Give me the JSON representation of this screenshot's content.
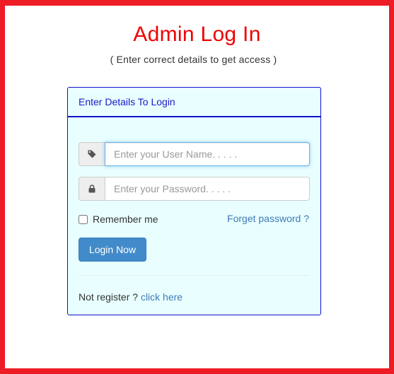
{
  "header": {
    "title": "Admin Log In",
    "subtitle": "( Enter correct details to get access )"
  },
  "panel": {
    "heading": "Enter Details To Login"
  },
  "form": {
    "username_placeholder": "Enter your User Name. . . . .",
    "username_icon": "tag-icon",
    "password_placeholder": "Enter your Password. . . . .",
    "password_icon": "lock-icon",
    "remember_label": "Remember me",
    "forgot_label": "Forget password ?",
    "login_label": "Login Now",
    "register_prefix": "Not register ?",
    "register_link": "click here"
  },
  "colors": {
    "frame": "#ee1c25",
    "title": "#ee0000",
    "panel_border": "#1010c8",
    "panel_bg": "#e9ffff",
    "button": "#428bca",
    "link": "#3c7ab8"
  }
}
